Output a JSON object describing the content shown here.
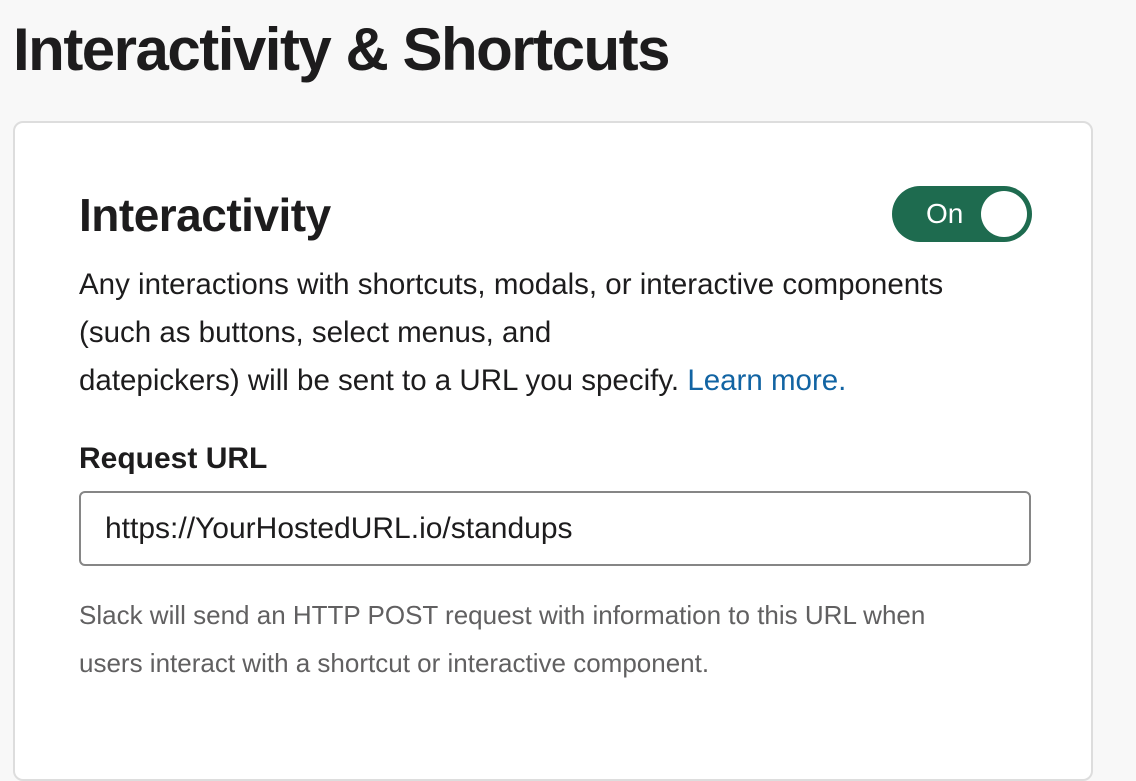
{
  "page": {
    "title": "Interactivity & Shortcuts"
  },
  "interactivity": {
    "title": "Interactivity",
    "toggle": {
      "label": "On",
      "state": true,
      "color": "#1e6b4f"
    },
    "description_lines": [
      "Any interactions with shortcuts, modals, or interactive components",
      "(such as buttons, select menus, and",
      "datepickers) will be sent to a URL you specify."
    ],
    "learn_more_label": "Learn more.",
    "request_url": {
      "label": "Request URL",
      "value": "https://YourHostedURL.io/standups"
    },
    "help_lines": [
      "Slack will send an HTTP POST request with information to this URL when",
      "users interact with a shortcut or interactive component."
    ]
  }
}
